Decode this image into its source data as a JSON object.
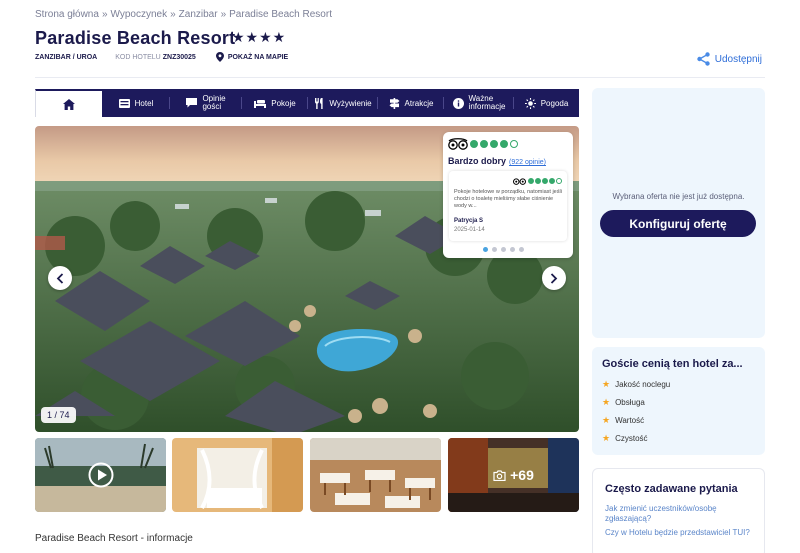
{
  "breadcrumb": [
    "Strona główna",
    "Wypoczynek",
    "Zanzibar",
    "Paradise Beach Resort"
  ],
  "breadcrumb_sep": "»",
  "hotel": {
    "name": "Paradise Beach Resort",
    "stars": "★★★★",
    "location": "ZANZIBAR / UROA",
    "code_label": "KOD HOTELU",
    "code": "ZNZ30025",
    "map_label": "POKAŻ NA MAPIE"
  },
  "share_label": "Udostępnij",
  "tabs": [
    {
      "icon": "home-icon",
      "label": ""
    },
    {
      "icon": "hotel-icon",
      "label": "Hotel"
    },
    {
      "icon": "comments-icon",
      "label": "Opinie gości",
      "line1": "Opinie",
      "line2": "gości"
    },
    {
      "icon": "bed-icon",
      "label": "Pokoje"
    },
    {
      "icon": "cutlery-icon",
      "label": "Wyżywienie"
    },
    {
      "icon": "signpost-icon",
      "label": "Atrakcje"
    },
    {
      "icon": "info-icon",
      "label": "Ważne informacje",
      "line1": "Ważne",
      "line2": "informacje"
    },
    {
      "icon": "sun-icon",
      "label": "Pogoda"
    }
  ],
  "gallery": {
    "counter": "1 / 74",
    "more_count": "+69"
  },
  "review": {
    "rating": 4.5,
    "rating_text": "Bardzo dobry",
    "count_text": "(922 opinie)",
    "inner_rating": 4,
    "text": "Pokoje hotelowe w porządku, natomiast jeśli chodzi o toaletę mieliśmy słabe ciśnienie wody w...",
    "author": "Patrycja S",
    "date": "2025-01-14",
    "pager_total": 5,
    "pager_active": 1
  },
  "info_heading": "Paradise Beach Resort - informacje",
  "offer": {
    "unavailable": "Wybrana oferta nie jest już dostępna.",
    "configure": "Konfiguruj ofertę"
  },
  "guests": {
    "title": "Goście cenią ten hotel za...",
    "items": [
      "Jakość noclegu",
      "Obsługa",
      "Wartość",
      "Czystość"
    ]
  },
  "faq": {
    "title": "Często zadawane pytania",
    "questions": [
      "Jak zmienić uczestników/osobę zgłaszającą?",
      "Czy w Hotelu będzie przedstawiciel TUI?"
    ]
  },
  "colors": {
    "navy": "#1d1a5c",
    "accent_blue": "#2f6ed8",
    "tripadvisor_green": "#35a86b",
    "star_orange": "#f5a623"
  }
}
